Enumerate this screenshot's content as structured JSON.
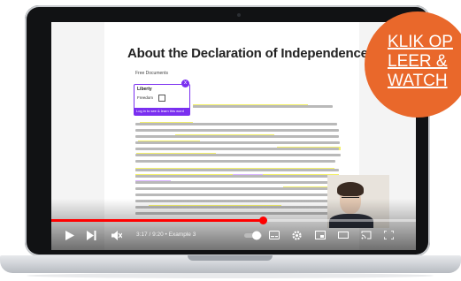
{
  "document": {
    "title": "About the Declaration of Independence",
    "subtitle": "Free Documents"
  },
  "popup": {
    "title": "Liberty",
    "field_label": "Freedom",
    "footer": "Log in to see & learn this word",
    "close_symbol": "x"
  },
  "video": {
    "time_label": "3:17 / 9:20 • Example 3",
    "progress": 0.58
  },
  "badge": {
    "lines": [
      "KLIK OP",
      "LEER &",
      "WATCH"
    ],
    "color": "#e9682b"
  },
  "colors": {
    "highlight_yellow": "#f3f06a",
    "highlight_purple": "#d9b3ff",
    "popup_accent": "#7a2ff0",
    "progress": "#ff0000"
  }
}
